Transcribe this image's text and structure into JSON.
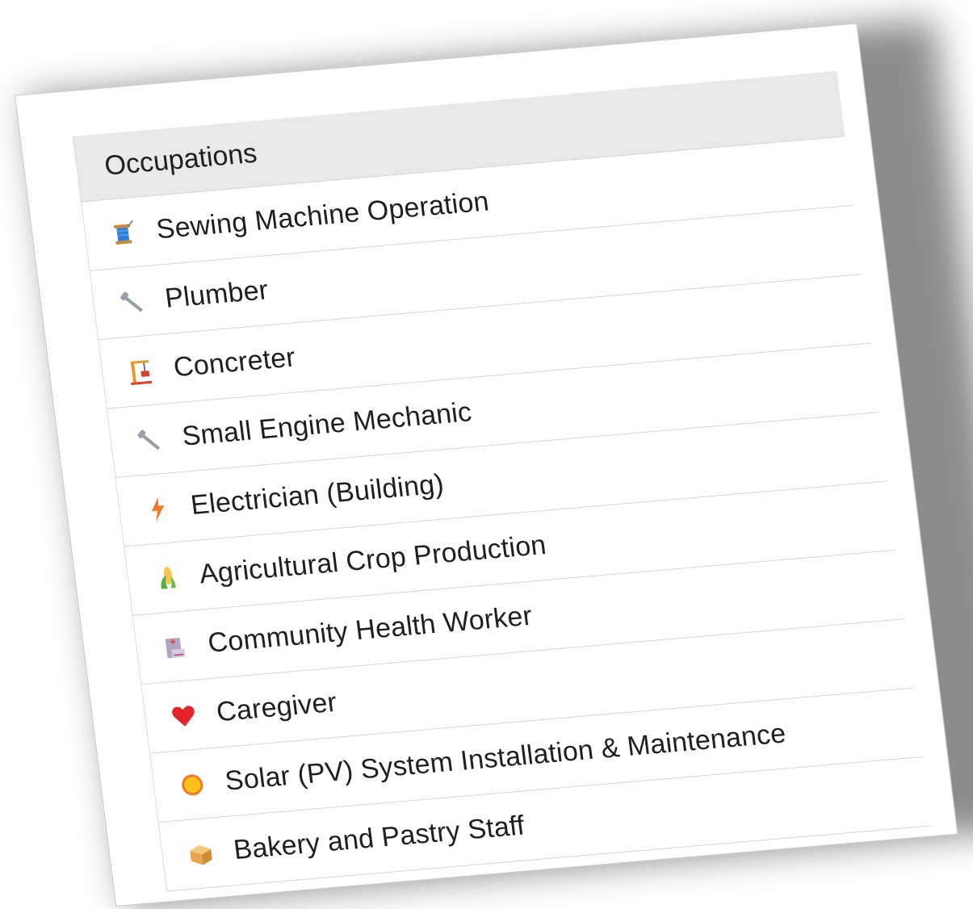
{
  "panel": {
    "title": "Occupations"
  },
  "occupations": [
    {
      "label": "Sewing Machine Operation",
      "icon": "sewing-spool-icon"
    },
    {
      "label": "Plumber",
      "icon": "wrench-icon"
    },
    {
      "label": "Concreter",
      "icon": "construction-crane-icon"
    },
    {
      "label": "Small Engine Mechanic",
      "icon": "wrench-icon"
    },
    {
      "label": "Electrician (Building)",
      "icon": "lightning-bolt-icon"
    },
    {
      "label": "Agricultural Crop Production",
      "icon": "corn-crop-icon"
    },
    {
      "label": "Community Health Worker",
      "icon": "clinic-building-icon"
    },
    {
      "label": "Caregiver",
      "icon": "red-heart-icon"
    },
    {
      "label": "Solar (PV) System Installation & Maintenance",
      "icon": "sun-icon"
    },
    {
      "label": "Bakery and Pastry Staff",
      "icon": "bread-box-icon"
    }
  ]
}
